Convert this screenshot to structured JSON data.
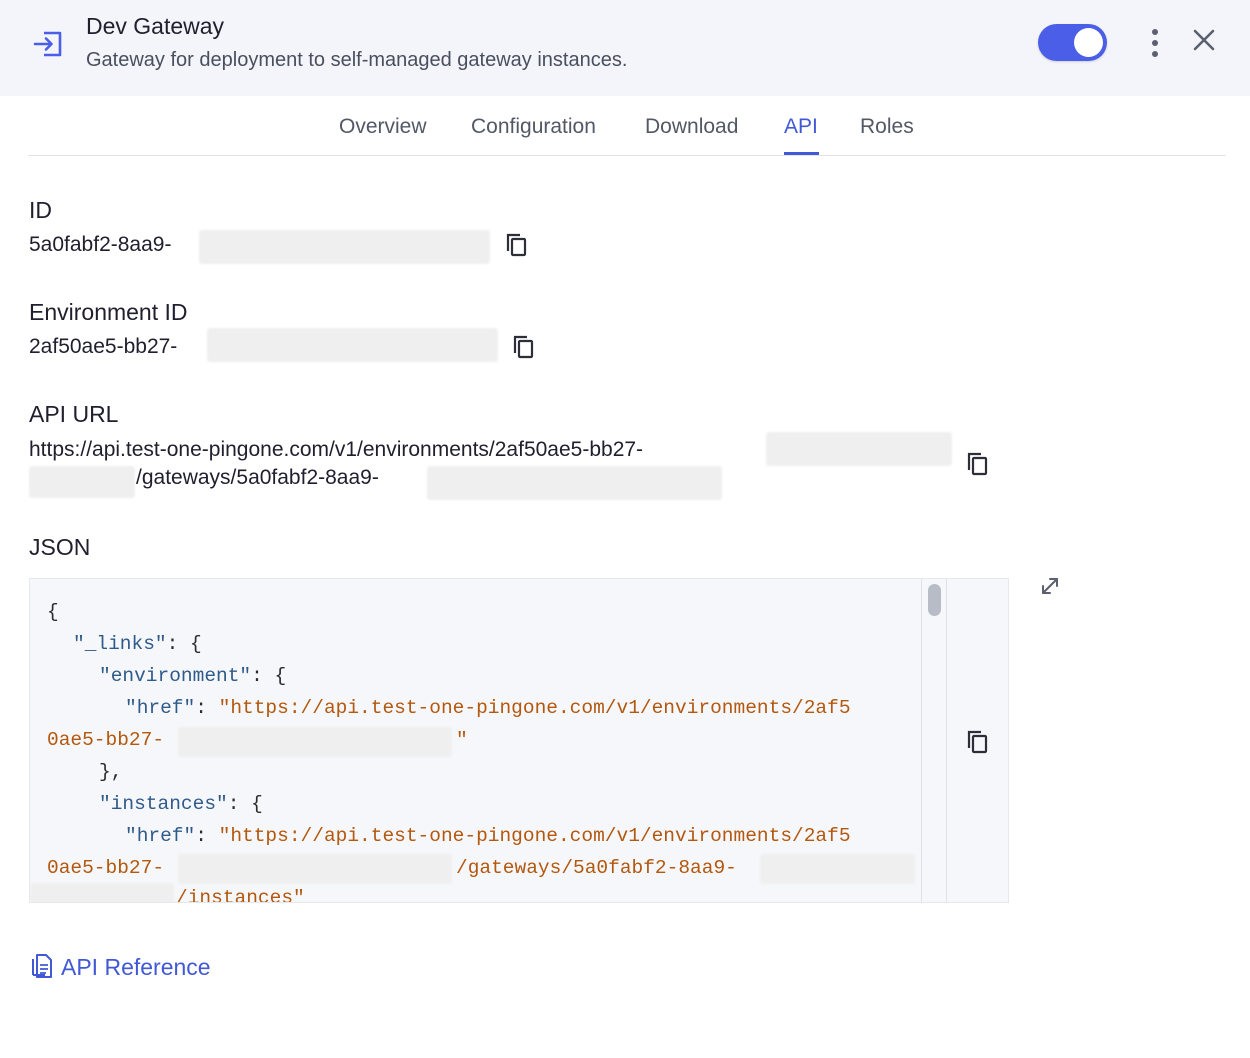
{
  "header": {
    "title": "Dev Gateway",
    "subtitle": "Gateway for deployment to self-managed gateway instances.",
    "icon": "sign-in-icon",
    "toggle_on": true
  },
  "tabs": [
    {
      "label": "Overview",
      "active": false
    },
    {
      "label": "Configuration",
      "active": false
    },
    {
      "label": "Download",
      "active": false
    },
    {
      "label": "API",
      "active": true
    },
    {
      "label": "Roles",
      "active": false
    }
  ],
  "fields": {
    "id": {
      "label": "ID",
      "value": "5a0fabf2-8aa9-"
    },
    "env_id": {
      "label": "Environment ID",
      "value": "2af50ae5-bb27-"
    },
    "api_url": {
      "label": "API URL",
      "line1": "https://api.test-one-pingone.com/v1/environments/2af50ae5-bb27-",
      "line2": "/gateways/5a0fabf2-8aa9-"
    }
  },
  "json": {
    "label": "JSON",
    "lines": [
      "{",
      "\"_links\"",
      "\"environment\"",
      "\"href\"",
      "\"https://api.test-one-pingone.com/v1/environments/2af5",
      "0ae5-bb27-",
      "},",
      "\"instances\"",
      "\"https://api.test-one-pingone.com/v1/environments/2af5",
      "0ae5-bb27-",
      "/gateways/5a0fabf2-8aa9-",
      "/instances\""
    ],
    "punct": {
      "colon_brace": ": {",
      "colon": ": ",
      "quote": "\""
    }
  },
  "api_reference": {
    "label": "API Reference",
    "icon": "document-icon"
  },
  "colors": {
    "accent": "#4159d6",
    "header_bg": "#f3f5fa",
    "json_string": "#b3580e",
    "json_key": "#2f5b8a"
  }
}
